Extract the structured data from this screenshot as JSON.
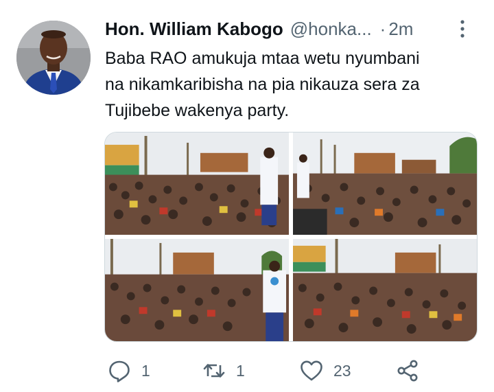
{
  "tweet": {
    "author": {
      "name": "Hon. William Kabogo",
      "handle": "@honka...",
      "avatar_icon": "profile-photo"
    },
    "separator": "·",
    "time": "2m",
    "text_lines": [
      "Baba RAO amukuja mtaa wetu nyumbani",
      "na nikamkaribisha na pia nikauza sera za",
      "Tujibebe wakenya party."
    ],
    "media": [
      {
        "icon": "crowd-photo"
      },
      {
        "icon": "crowd-photo"
      },
      {
        "icon": "crowd-photo"
      },
      {
        "icon": "crowd-photo"
      }
    ],
    "actions": {
      "reply": {
        "icon": "reply-icon",
        "count": "1"
      },
      "retweet": {
        "icon": "retweet-icon",
        "count": "1"
      },
      "like": {
        "icon": "heart-icon",
        "count": "23"
      },
      "share": {
        "icon": "share-icon"
      }
    }
  },
  "colors": {
    "text": "#0f1419",
    "secondary": "#536471",
    "border": "#cfd9de"
  }
}
